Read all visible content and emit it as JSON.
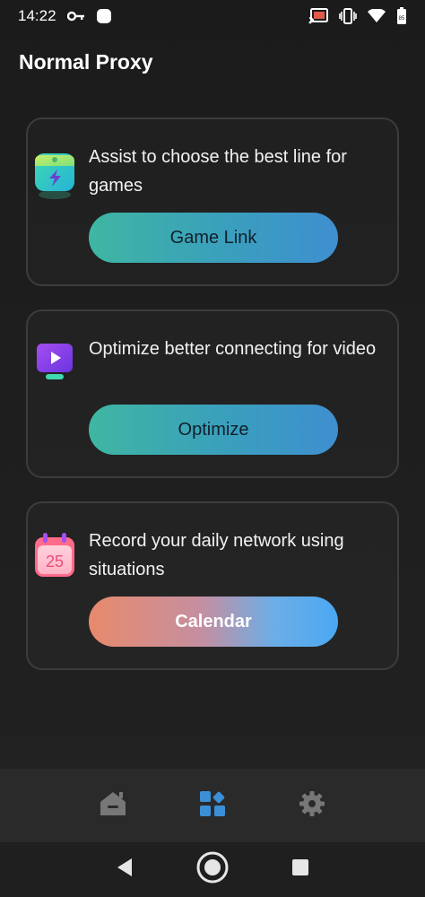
{
  "status_bar": {
    "time": "14:22",
    "icons": [
      "key-icon",
      "notification-dot-icon",
      "cast-icon",
      "vibrate-icon",
      "wifi-icon",
      "battery-icon"
    ]
  },
  "app": {
    "title": "Normal Proxy"
  },
  "cards": [
    {
      "icon": "game-cube-icon",
      "text": "Assist to choose the best line for games",
      "button": "Game Link",
      "button_style": "teal"
    },
    {
      "icon": "video-monitor-icon",
      "text": "Optimize better connecting for video",
      "button": "Optimize",
      "button_style": "teal"
    },
    {
      "icon": "calendar-icon",
      "text": "Record your daily network using situations",
      "button": "Calendar",
      "button_style": "sunset",
      "calendar_day": "25"
    }
  ],
  "bottom_nav": {
    "items": [
      {
        "icon": "home-icon",
        "active": false
      },
      {
        "icon": "dashboard-icon",
        "active": true
      },
      {
        "icon": "gear-icon",
        "active": false
      }
    ],
    "active_color": "#3b8fd6",
    "inactive_color": "#777777"
  },
  "system_nav": [
    "back-icon",
    "home-circle-icon",
    "recents-icon"
  ]
}
